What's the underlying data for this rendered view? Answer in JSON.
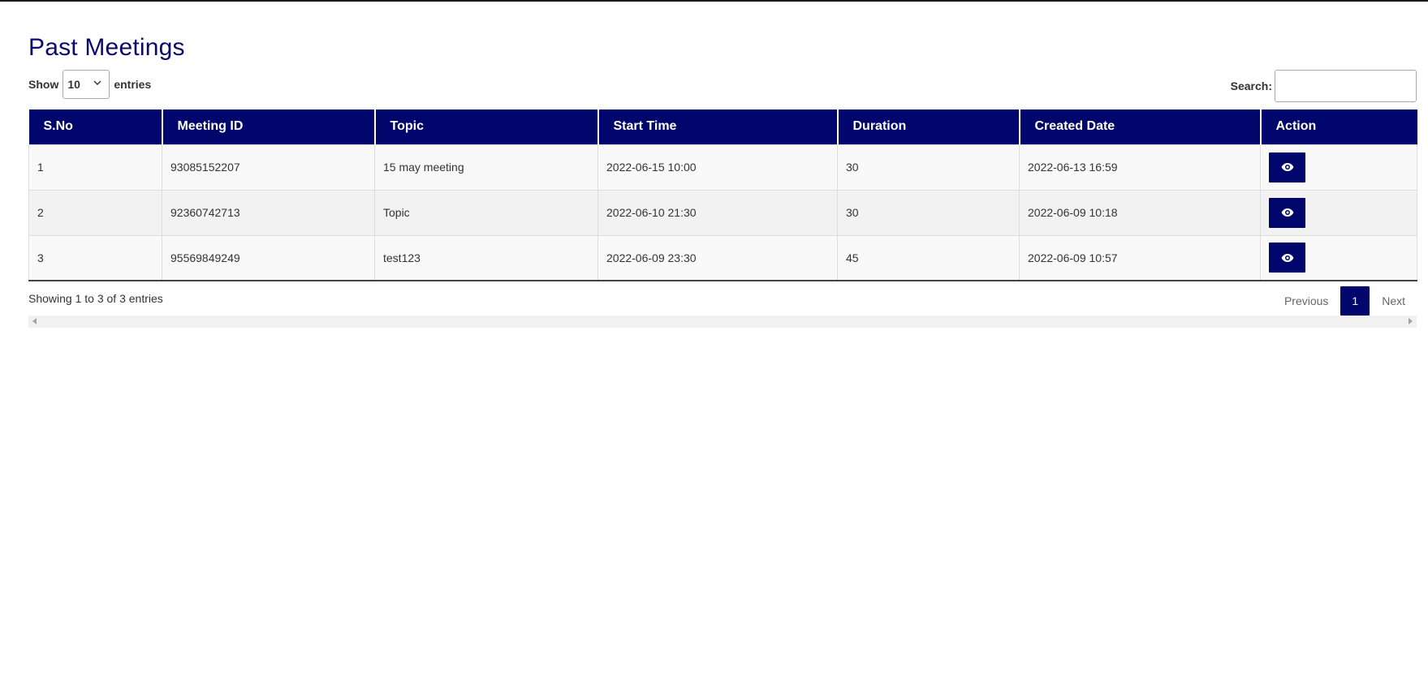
{
  "page": {
    "title": "Past Meetings"
  },
  "length_menu": {
    "show_label": "Show",
    "selected": "10",
    "entries_label": "entries"
  },
  "search": {
    "label": "Search:",
    "value": "",
    "placeholder": ""
  },
  "table": {
    "columns": [
      "S.No",
      "Meeting ID",
      "Topic",
      "Start Time",
      "Duration",
      "Created Date",
      "Action"
    ],
    "rows": [
      {
        "sno": "1",
        "meeting_id": "93085152207",
        "topic": "15 may meeting",
        "start_time": "2022-06-15 10:00",
        "duration": "30",
        "created_date": "2022-06-13 16:59"
      },
      {
        "sno": "2",
        "meeting_id": "92360742713",
        "topic": "Topic",
        "start_time": "2022-06-10 21:30",
        "duration": "30",
        "created_date": "2022-06-09 10:18"
      },
      {
        "sno": "3",
        "meeting_id": "95569849249",
        "topic": "test123",
        "start_time": "2022-06-09 23:30",
        "duration": "45",
        "created_date": "2022-06-09 10:57"
      }
    ],
    "action_icon": "eye-icon"
  },
  "footer": {
    "info": "Showing 1 to 3 of 3 entries",
    "previous_label": "Previous",
    "current_page": "1",
    "next_label": "Next"
  },
  "colors": {
    "primary": "#00066b",
    "title": "#0a0a6e"
  }
}
